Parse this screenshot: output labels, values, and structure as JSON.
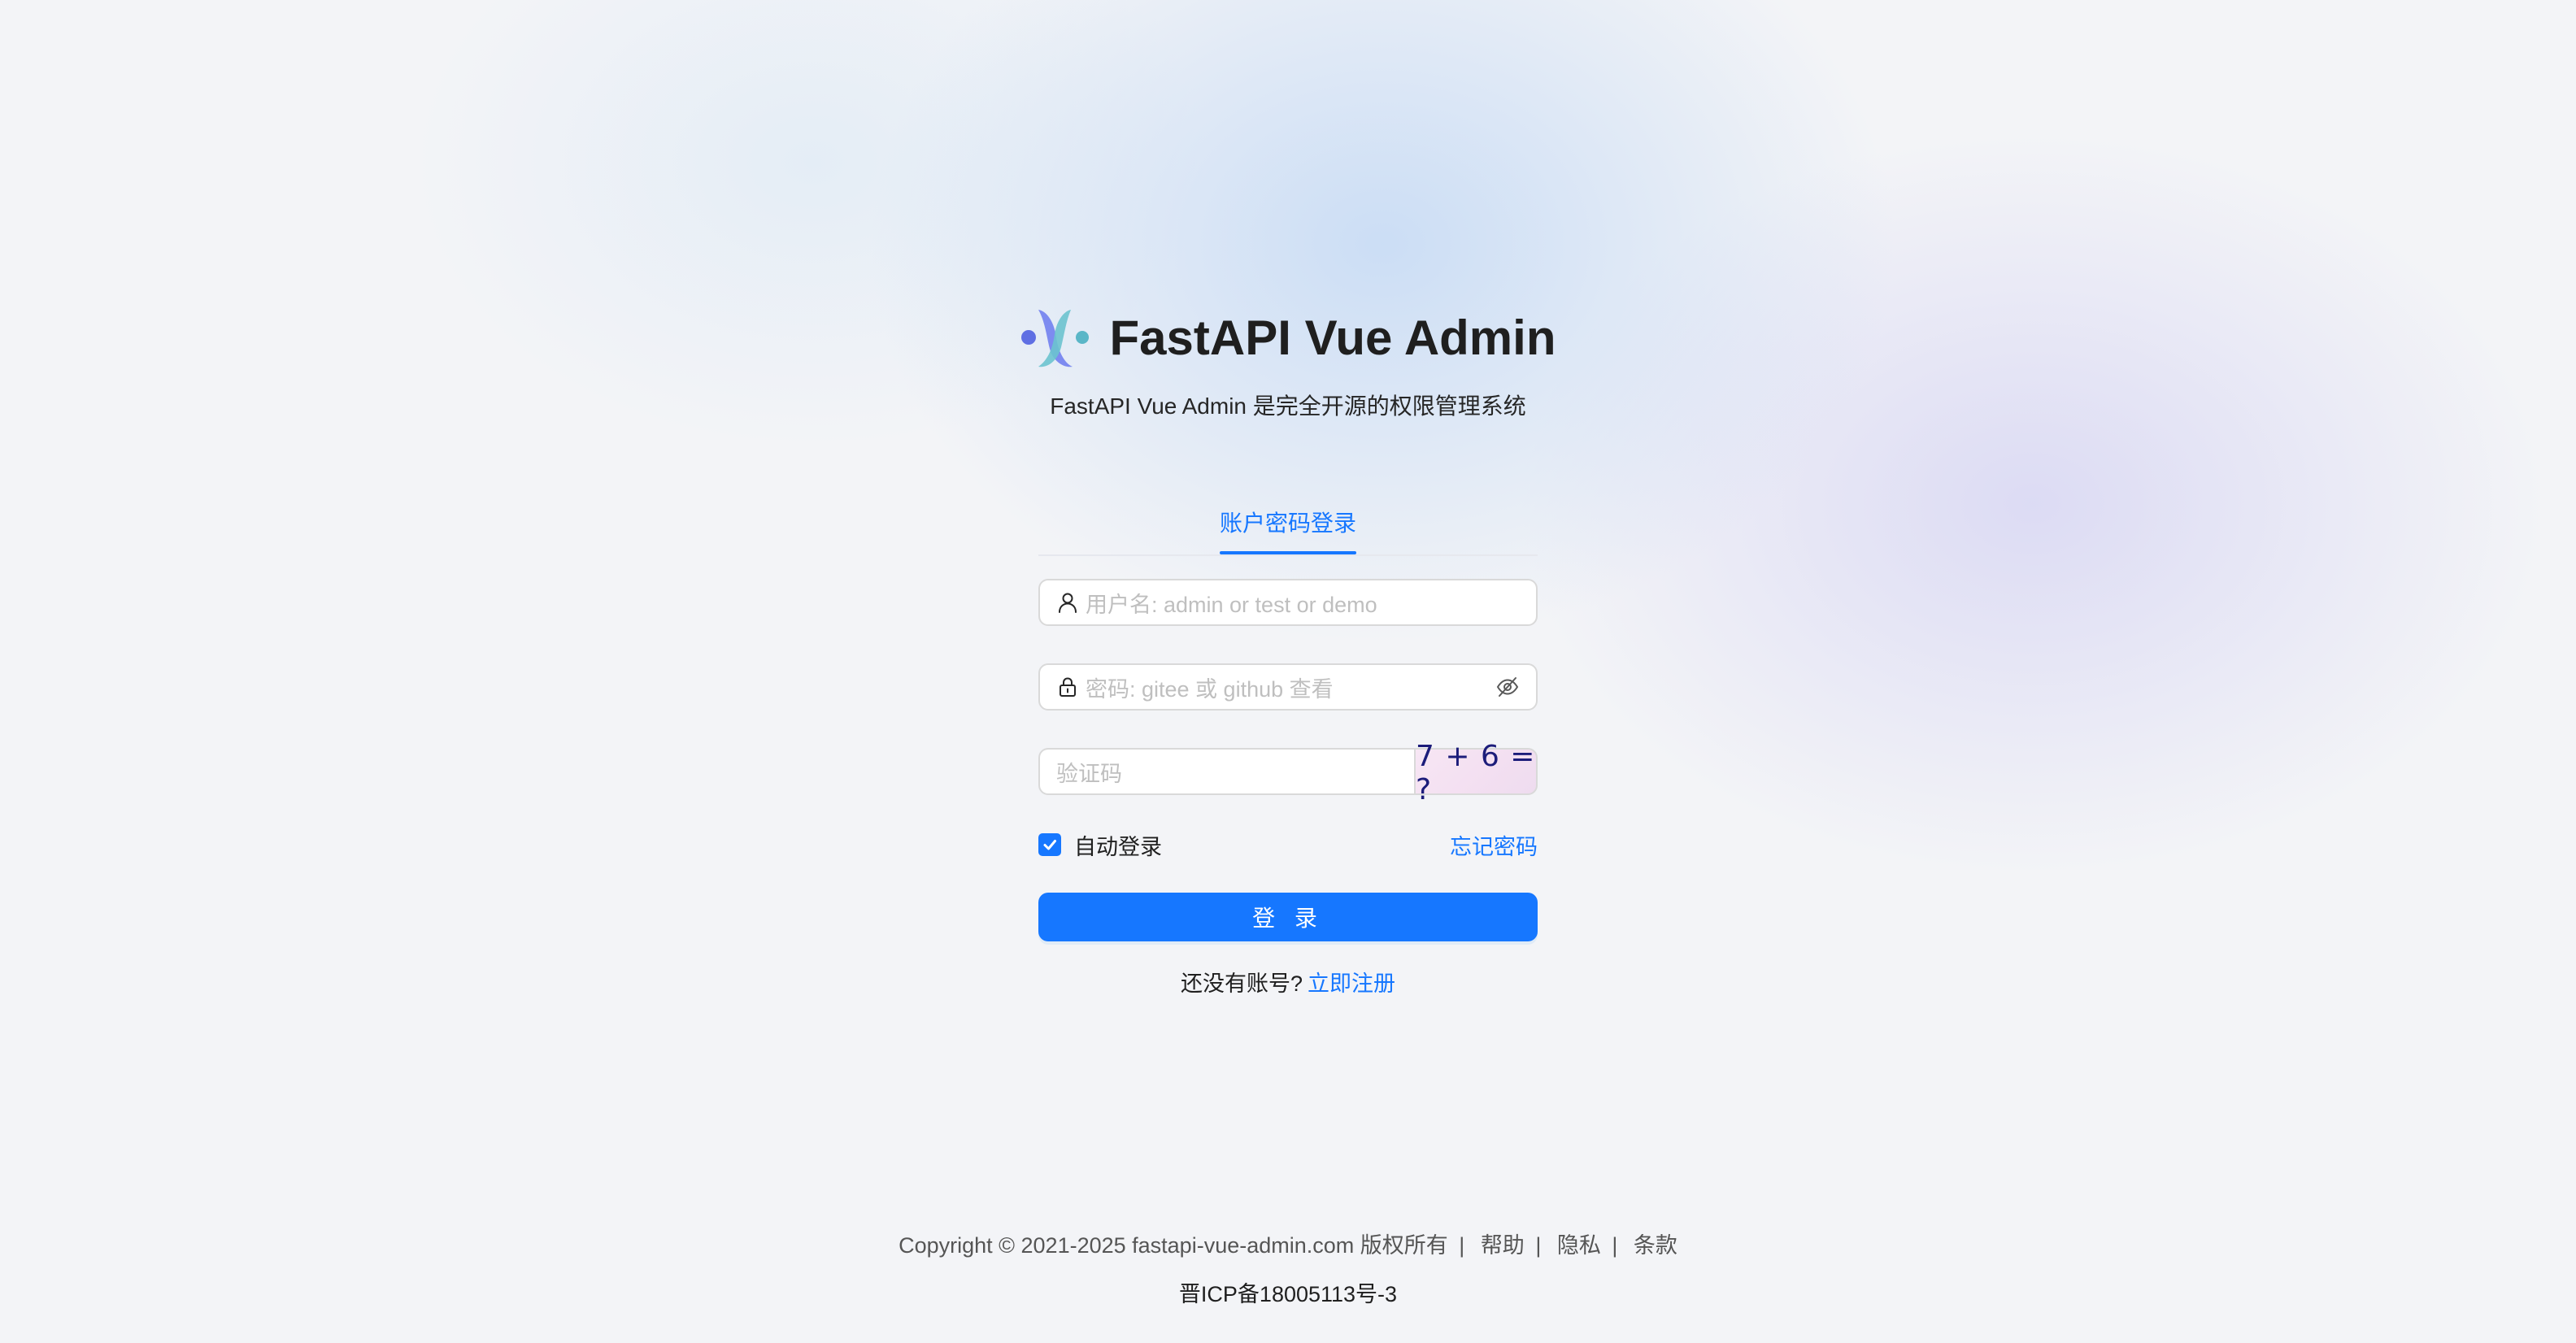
{
  "app": {
    "title": "FastAPI Vue Admin",
    "subtitle": "FastAPI Vue Admin 是完全开源的权限管理系统",
    "logo_icon": "fastapi-vue-admin-logo"
  },
  "login": {
    "tab_label": "账户密码登录",
    "username_placeholder": "用户名: admin or test or demo",
    "username_value": "",
    "username_icon": "user-icon",
    "password_placeholder": "密码: gitee 或 github 查看",
    "password_value": "",
    "password_icon": "lock-icon",
    "password_toggle_icon": "eye-invisible-icon",
    "captcha_placeholder": "验证码",
    "captcha_value": "",
    "captcha_text": "7 + 6 = ?",
    "remember_label": "自动登录",
    "remember_checked": true,
    "forgot_label": "忘记密码",
    "submit_label": "登 录",
    "register_prompt": "还没有账号?",
    "register_link": "立即注册"
  },
  "footer": {
    "copyright": "Copyright © 2021-2025 fastapi-vue-admin.com 版权所有",
    "links": [
      "帮助",
      "隐私",
      "条款"
    ],
    "separator": "|",
    "icp": "晋ICP备18005113号-3"
  },
  "colors": {
    "primary": "#1677ff",
    "background": "#f3f4f7",
    "text": "#1f1f1f",
    "placeholder": "#bfbfbf",
    "border": "#d9d9d9"
  }
}
